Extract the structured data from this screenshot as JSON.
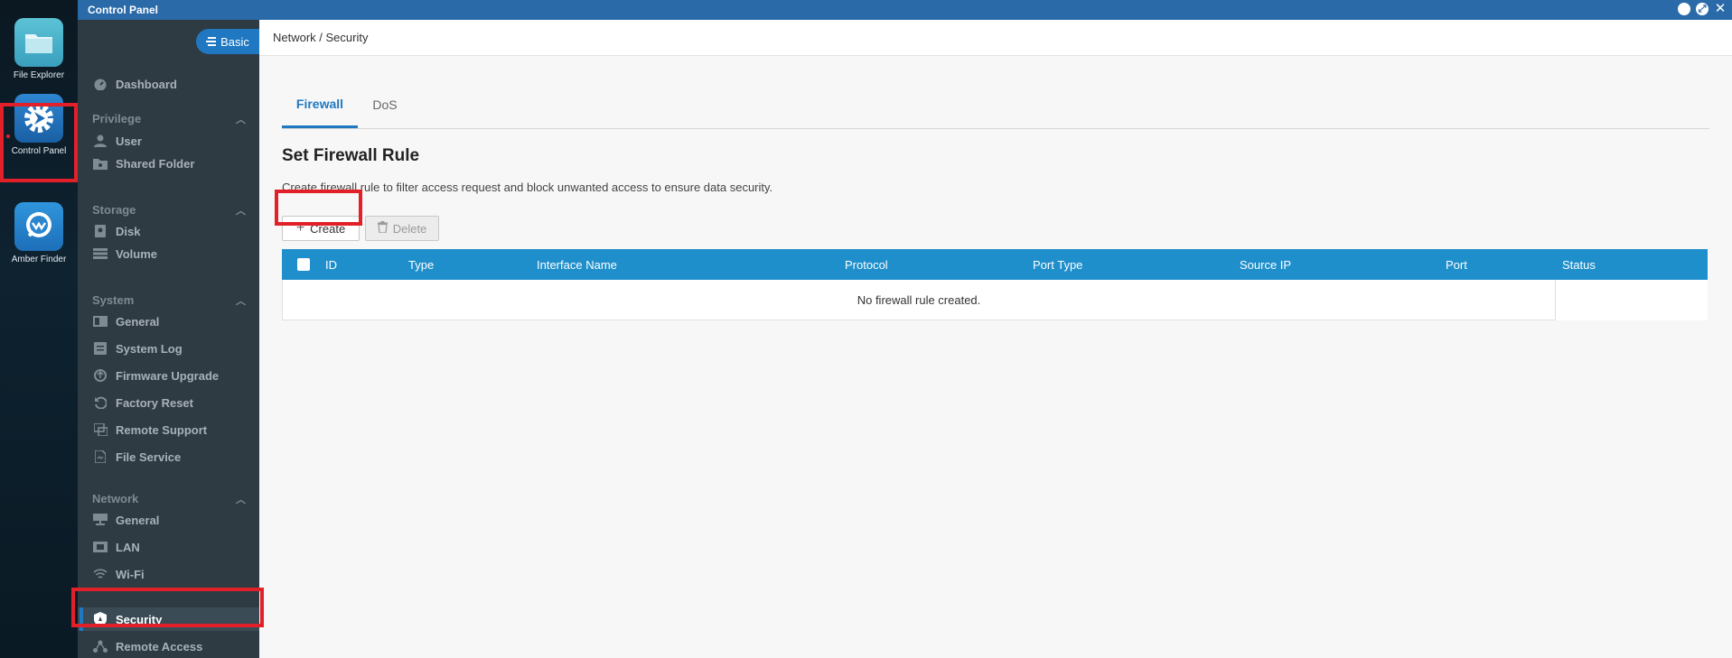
{
  "dock": {
    "apps": [
      {
        "label": "File Explorer",
        "icon": "folder-icon"
      },
      {
        "label": "Control Panel",
        "icon": "gear-icon"
      },
      {
        "label": "Amber Finder",
        "icon": "finder-icon"
      }
    ]
  },
  "window": {
    "title": "Control Panel"
  },
  "sidebar": {
    "mode_button": "Basic",
    "dashboard": "Dashboard",
    "sections": {
      "privilege": {
        "title": "Privilege",
        "items": [
          "User",
          "Shared Folder"
        ]
      },
      "storage": {
        "title": "Storage",
        "items": [
          "Disk",
          "Volume"
        ]
      },
      "system": {
        "title": "System",
        "items": [
          "General",
          "System Log",
          "Firmware Upgrade",
          "Factory Reset",
          "Remote Support",
          "File Service"
        ]
      },
      "network": {
        "title": "Network",
        "items": [
          "General",
          "LAN",
          "Wi-Fi",
          "Security",
          "Remote Access"
        ]
      }
    }
  },
  "main": {
    "breadcrumb": "Network / Security",
    "tabs": [
      {
        "label": "Firewall",
        "active": true
      },
      {
        "label": "DoS",
        "active": false
      }
    ],
    "title": "Set Firewall Rule",
    "description": "Create firewall rule to filter access request and block unwanted access to ensure data security.",
    "create_label": "Create",
    "delete_label": "Delete",
    "table": {
      "columns": [
        "ID",
        "Type",
        "Interface Name",
        "Protocol",
        "Port Type",
        "Source IP",
        "Port",
        "Status"
      ],
      "empty_message": "No firewall rule created."
    }
  },
  "colors": {
    "accent": "#1f78c1",
    "table_header": "#1f8fcc",
    "highlight": "#e2202a",
    "sidebar_bg": "#2f3b43"
  }
}
